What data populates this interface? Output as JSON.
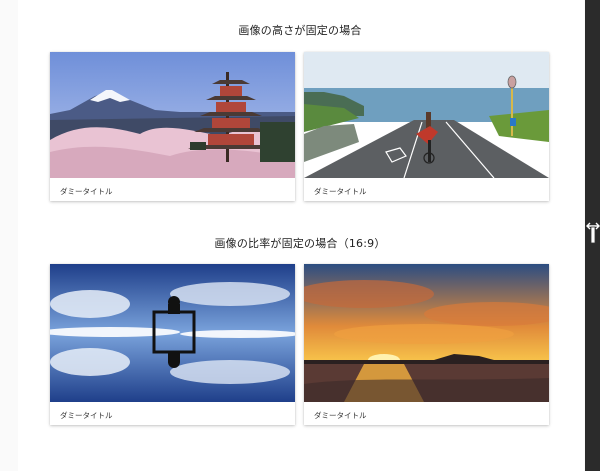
{
  "sections": [
    {
      "title": "画像の高さが固定の場合"
    },
    {
      "title": "画像の比率が固定の場合（16:9）"
    }
  ],
  "cards": [
    {
      "caption": "ダミータイトル",
      "image": "fuji-pagoda-cherry-blossoms"
    },
    {
      "caption": "ダミータイトル",
      "image": "cyclist-coastal-road"
    },
    {
      "caption": "ダミータイトル",
      "image": "sky-mirror-reflection-frame"
    },
    {
      "caption": "ダミータイトル",
      "image": "sunset-beach"
    }
  ]
}
